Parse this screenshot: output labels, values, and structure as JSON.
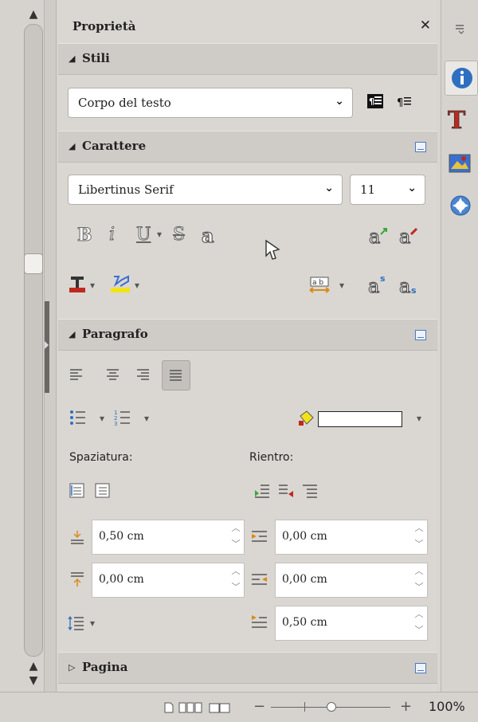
{
  "sidebar": {
    "title": "Proprietà",
    "close_icon": "close-icon",
    "sections": {
      "stili": {
        "label": "Stili",
        "style_value": "Corpo del testo"
      },
      "carattere": {
        "label": "Carattere",
        "font_name": "Libertinus Serif",
        "font_size": "11",
        "format_buttons": [
          "bold-icon",
          "italic-icon",
          "underline-icon",
          "strikethrough-icon",
          "shadow-icon"
        ]
      },
      "paragrafo": {
        "label": "Paragrafo",
        "spacing_label": "Spaziatura:",
        "indent_label": "Rientro:",
        "above_spacing": "0,50 cm",
        "below_spacing": "0,00 cm",
        "before_indent": "0,00 cm",
        "after_indent": "0,00 cm",
        "first_line_indent": "0,50 cm"
      },
      "pagina": {
        "label": "Pagina"
      }
    }
  },
  "statusbar": {
    "zoom": "100%",
    "zoom_minus": "−",
    "zoom_plus": "+"
  },
  "colors": {
    "accent": "#2f6fc0",
    "highlight_yellow": "#f2e21a",
    "font_color_red": "#c0281d",
    "green": "#3aa63a"
  }
}
